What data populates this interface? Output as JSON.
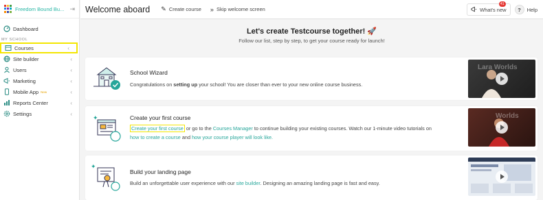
{
  "sidebar": {
    "brand": "Freedom Bound Bu...",
    "brand_colors": [
      "#e53935",
      "#fbc02d",
      "#43a047",
      "#1e88e5",
      "#8e24aa",
      "#00acc1",
      "#fb8c00",
      "#3949ab",
      "#7cb342"
    ],
    "dashboard": "Dashboard",
    "section": "MY SCHOOL",
    "items": [
      {
        "label": "Courses",
        "icon": "courses-icon"
      },
      {
        "label": "Site builder",
        "icon": "globe-icon"
      },
      {
        "label": "Users",
        "icon": "user-icon"
      },
      {
        "label": "Marketing",
        "icon": "megaphone-icon"
      },
      {
        "label": "Mobile App",
        "icon": "mobile-icon",
        "badge": "New"
      },
      {
        "label": "Reports Center",
        "icon": "chart-icon"
      },
      {
        "label": "Settings",
        "icon": "gear-icon"
      }
    ]
  },
  "topbar": {
    "title": "Welcome aboard",
    "create_course": "Create course",
    "skip": "Skip welcome screen",
    "whats_new": "What's new",
    "whats_new_count": "41",
    "help": "Help"
  },
  "hero": {
    "title": "Let's create Testcourse together! 🚀",
    "subtitle": "Follow our list, step by step, to get your course ready for launch!"
  },
  "cards": {
    "wizard": {
      "title": "School Wizard",
      "desc_pre": "Congratulations on ",
      "desc_bold": "setting up",
      "desc_post": " your school! You are closer than ever to your new online course business.",
      "thumb_text": "Lara Worlds"
    },
    "create": {
      "title": "Create your first course",
      "link1": "Create your first course",
      "text1": " or go to the ",
      "link2": "Courses Manager",
      "text2": " to continue building your existing courses. Watch our 1-minute video tutorials on",
      "link3": "how to create a course",
      "text3": " and ",
      "link4": "how your course player will look like.",
      "thumb_text": "Worlds"
    },
    "landing": {
      "title": "Build your landing page",
      "text1": "Build an unforgettable user experience with our ",
      "link1": "site builder",
      "text2": ". Designing an amazing landing page is fast and easy."
    }
  },
  "colors": {
    "accent": "#26a69a",
    "highlight": "#f3e600",
    "badge": "#e53935"
  }
}
